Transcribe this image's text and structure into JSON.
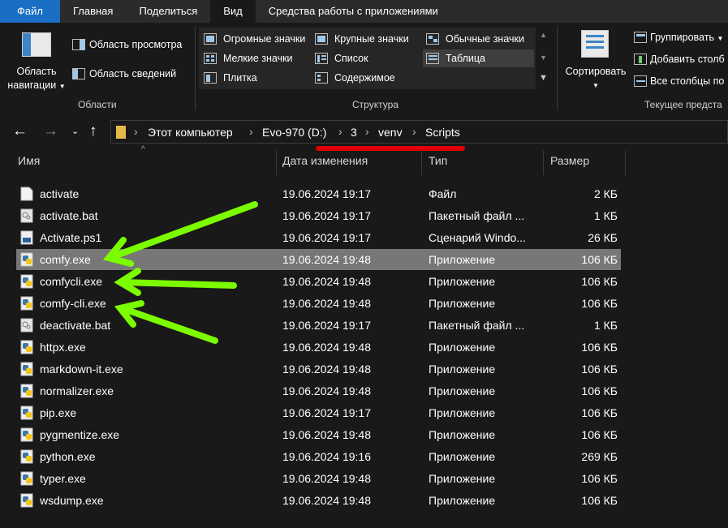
{
  "ribbon_tabs": [
    "Файл",
    "Главная",
    "Поделиться",
    "Вид",
    "Средства работы с приложениями"
  ],
  "panes": {
    "nav_pane_label_1": "Область",
    "nav_pane_label_2": "навигации",
    "preview": "Область просмотра",
    "details": "Область сведений",
    "group": "Области"
  },
  "layout": {
    "items": [
      "Огромные значки",
      "Крупные значки",
      "Обычные значки",
      "Мелкие значки",
      "Список",
      "Таблица",
      "Плитка",
      "Содержимое"
    ],
    "selected": "Таблица",
    "group": "Структура"
  },
  "current_view": {
    "sort": "Сортировать",
    "group_by": "Группировать",
    "add_columns": "Добавить столб",
    "fit_columns": "Все столбцы по",
    "group": "Текущее предста"
  },
  "breadcrumb": [
    "Этот компьютер",
    "Evo-970 (D:)",
    "3",
    "venv",
    "Scripts"
  ],
  "columns": {
    "name": "Имя",
    "date": "Дата изменения",
    "type": "Тип",
    "size": "Размер"
  },
  "files": [
    {
      "name": "activate",
      "date": "19.06.2024 19:17",
      "type": "Файл",
      "size": "2 КБ",
      "icon": "file-icon"
    },
    {
      "name": "activate.bat",
      "date": "19.06.2024 19:17",
      "type": "Пакетный файл ...",
      "size": "1 КБ",
      "icon": "batch-file-icon"
    },
    {
      "name": "Activate.ps1",
      "date": "19.06.2024 19:17",
      "type": "Сценарий Windo...",
      "size": "26 КБ",
      "icon": "powershell-file-icon"
    },
    {
      "name": "comfy.exe",
      "date": "19.06.2024 19:48",
      "type": "Приложение",
      "size": "106 КБ",
      "icon": "python-exe-icon",
      "selected": true
    },
    {
      "name": "comfycli.exe",
      "date": "19.06.2024 19:48",
      "type": "Приложение",
      "size": "106 КБ",
      "icon": "python-exe-icon"
    },
    {
      "name": "comfy-cli.exe",
      "date": "19.06.2024 19:48",
      "type": "Приложение",
      "size": "106 КБ",
      "icon": "python-exe-icon"
    },
    {
      "name": "deactivate.bat",
      "date": "19.06.2024 19:17",
      "type": "Пакетный файл ...",
      "size": "1 КБ",
      "icon": "batch-file-icon"
    },
    {
      "name": "httpx.exe",
      "date": "19.06.2024 19:48",
      "type": "Приложение",
      "size": "106 КБ",
      "icon": "python-exe-icon"
    },
    {
      "name": "markdown-it.exe",
      "date": "19.06.2024 19:48",
      "type": "Приложение",
      "size": "106 КБ",
      "icon": "python-exe-icon"
    },
    {
      "name": "normalizer.exe",
      "date": "19.06.2024 19:48",
      "type": "Приложение",
      "size": "106 КБ",
      "icon": "python-exe-icon"
    },
    {
      "name": "pip.exe",
      "date": "19.06.2024 19:17",
      "type": "Приложение",
      "size": "106 КБ",
      "icon": "python-exe-icon"
    },
    {
      "name": "pygmentize.exe",
      "date": "19.06.2024 19:48",
      "type": "Приложение",
      "size": "106 КБ",
      "icon": "python-exe-icon"
    },
    {
      "name": "python.exe",
      "date": "19.06.2024 19:16",
      "type": "Приложение",
      "size": "269 КБ",
      "icon": "python-exe-icon"
    },
    {
      "name": "typer.exe",
      "date": "19.06.2024 19:48",
      "type": "Приложение",
      "size": "106 КБ",
      "icon": "python-exe-icon"
    },
    {
      "name": "wsdump.exe",
      "date": "19.06.2024 19:48",
      "type": "Приложение",
      "size": "106 КБ",
      "icon": "python-exe-icon"
    }
  ],
  "colors": {
    "file_tab": "#1a6fc4",
    "selected_row": "#777777",
    "annotation_arrow": "#7CFC00",
    "annotation_underline": "#e00000"
  }
}
